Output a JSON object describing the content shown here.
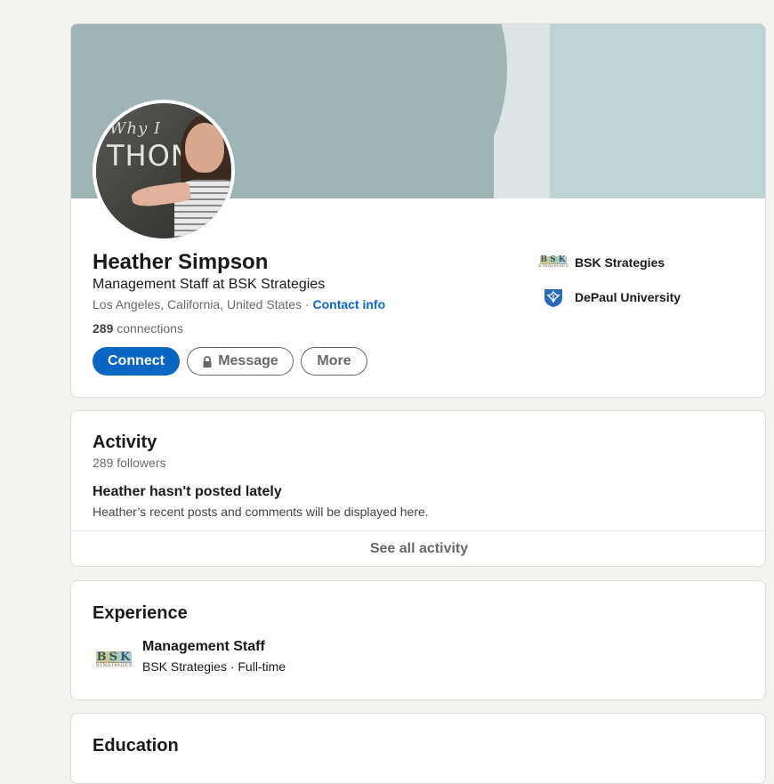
{
  "profile": {
    "name": "Heather Simpson",
    "headline": "Management Staff at BSK Strategies",
    "location": "Los Angeles, California, United States",
    "separator": " · ",
    "contact_info_label": "Contact info",
    "connections_count": "289",
    "connections_label": " connections",
    "buttons": {
      "connect": "Connect",
      "message": "Message",
      "more": "More"
    },
    "sidebar": {
      "company": "BSK Strategies",
      "school": "DePaul University"
    },
    "avatar_text": {
      "line1": "Why I",
      "line2": "THON"
    }
  },
  "activity": {
    "title": "Activity",
    "followers": "289 followers",
    "empty_heading": "Heather hasn't posted lately",
    "empty_desc": "Heather’s recent posts and comments will be displayed here.",
    "see_all": "See all activity"
  },
  "experience": {
    "title": "Experience",
    "items": [
      {
        "role": "Management Staff",
        "company_line": "BSK Strategies · Full-time"
      }
    ]
  },
  "education": {
    "title": "Education"
  },
  "logos": {
    "bsk_letters": [
      "B",
      "S",
      "K"
    ],
    "bsk_subtitle": "STRATEGIES"
  },
  "colors": {
    "accent": "#0a66c2",
    "page_bg": "#f3f2ef",
    "banner": "#a0b3b6",
    "banner_light": "#bfd2d5"
  }
}
